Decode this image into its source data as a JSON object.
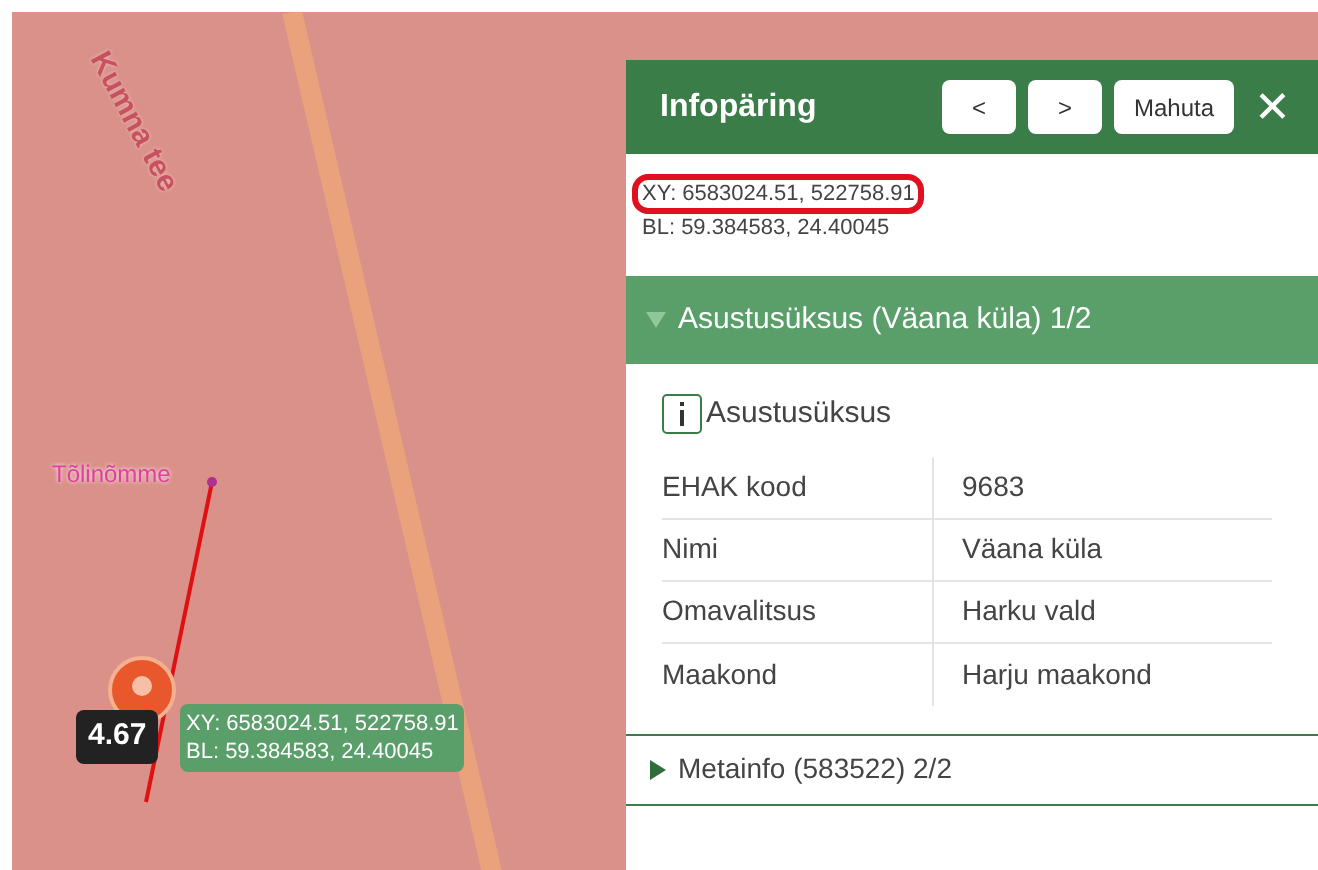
{
  "map": {
    "road_label": "Kumna tee",
    "place_label": "Tõlinõmme",
    "measurement": "4.67",
    "tooltip": [
      "XY: 6583024.51, 522758.91",
      "BL: 59.384583, 24.40045"
    ]
  },
  "panel": {
    "title": "Infopäring",
    "buttons": [
      {
        "label": "<"
      },
      {
        "label": ">"
      },
      {
        "label": "Mahuta"
      }
    ],
    "close": "✕",
    "coordinates": [
      {
        "text": "XY: 6583024.51, 522758.91",
        "highlighted": true
      },
      {
        "text": "BL: 59.384583, 24.40045",
        "highlighted": false
      }
    ],
    "sections": [
      {
        "title": "Asustusüksus (Väana küla) 1/2",
        "expanded": true,
        "heading": "Asustusüksus",
        "rows": [
          {
            "label": "EHAK kood",
            "value": "9683"
          },
          {
            "label": "Nimi",
            "value": "Väana küla"
          },
          {
            "label": "Omavalitsus",
            "value": "Harku vald"
          },
          {
            "label": "Maakond",
            "value": "Harju maakond"
          }
        ]
      },
      {
        "title": "Metainfo (583522) 2/2",
        "expanded": false
      }
    ]
  }
}
